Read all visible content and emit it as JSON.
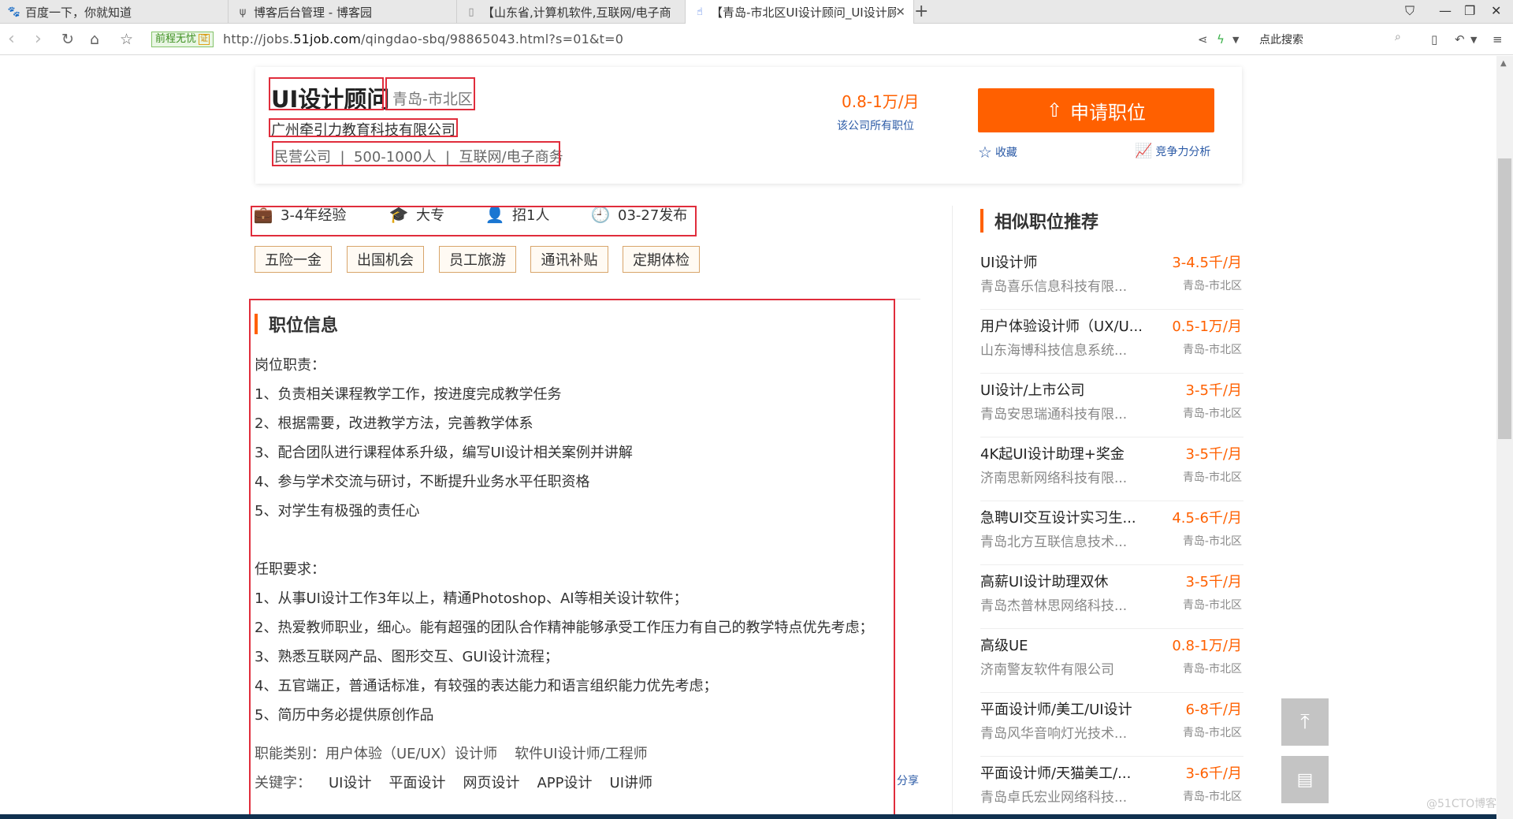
{
  "browser": {
    "tabs": [
      {
        "title": "百度一下，你就知道",
        "icon": "baidu-paw-icon",
        "active": false
      },
      {
        "title": "博客后台管理 - 博客园",
        "icon": "cnblogs-icon",
        "active": false
      },
      {
        "title": "【山东省,计算机软件,互联网/电子商",
        "icon": "page-icon",
        "active": false
      },
      {
        "title": "【青岛-市北区UI设计顾问_UI设计顾",
        "icon": "hand-icon",
        "active": true
      }
    ],
    "secure_label": "前程无忧",
    "secure_cert": "证",
    "url_prefix": "http://jobs.",
    "url_domain": "51job.com",
    "url_path": "/qingdao-sbq/98865043.html?s=01&t=0",
    "search_placeholder": "点此搜索"
  },
  "job": {
    "title": "UI设计顾问",
    "location": "青岛-市北区",
    "company": "广州牵引力教育科技有限公司",
    "company_meta": "民营公司  |  500-1000人  |  互联网/电子商务",
    "salary": "0.8-1万/月",
    "all_jobs_link": "该公司所有职位",
    "apply_label": "申请职位",
    "favorite_label": "收藏",
    "analysis_label": "竞争力分析"
  },
  "requirements": [
    {
      "icon": "briefcase-icon",
      "text": "3-4年经验"
    },
    {
      "icon": "graduation-cap-icon",
      "text": "大专"
    },
    {
      "icon": "person-icon",
      "text": "招1人"
    },
    {
      "icon": "clock-icon",
      "text": "03-27发布"
    }
  ],
  "welfare": [
    "五险一金",
    "出国机会",
    "员工旅游",
    "通讯补贴",
    "定期体检"
  ],
  "description": {
    "heading": "职位信息",
    "lines": [
      "岗位职责：",
      "1、负责相关课程教学工作，按进度完成教学任务",
      "2、根据需要，改进教学方法，完善教学体系",
      "3、配合团队进行课程体系升级，编写UI设计相关案例并讲解",
      "4、参与学术交流与研讨，不断提升业务水平任职资格",
      "5、对学生有极强的责任心",
      "",
      "任职要求：",
      "1、从事UI设计工作3年以上，精通Photoshop、AI等相关设计软件；",
      "2、热爱教师职业，细心。能有超强的团队合作精神能够承受工作压力有自己的教学特点优先考虑；",
      "3、熟悉互联网产品、图形交互、GUI设计流程；",
      "4、五官端正，普通话标准，有较强的表达能力和语言组织能力优先考虑；",
      "5、简历中务必提供原创作品"
    ],
    "category_label": "职能类别：",
    "categories": [
      "用户体验（UE/UX）设计师",
      "软件UI设计师/工程师"
    ],
    "keyword_label": "关键字：",
    "keywords": [
      "UI设计",
      "平面设计",
      "网页设计",
      "APP设计",
      "UI讲师"
    ],
    "share_label": "分享"
  },
  "recommend": {
    "heading": "相似职位推荐",
    "items": [
      {
        "title": "UI设计师",
        "salary": "3-4.5千/月",
        "company": "青岛喜乐信息科技有限...",
        "location": "青岛-市北区"
      },
      {
        "title": "用户体验设计师（UX/U...",
        "salary": "0.5-1万/月",
        "company": "山东海博科技信息系统...",
        "location": "青岛-市北区"
      },
      {
        "title": "UI设计/上市公司",
        "salary": "3-5千/月",
        "company": "青岛安思瑞通科技有限...",
        "location": "青岛-市北区"
      },
      {
        "title": "4K起UI设计助理+奖金",
        "salary": "3-5千/月",
        "company": "济南思新网络科技有限...",
        "location": "青岛-市北区"
      },
      {
        "title": "急聘UI交互设计实习生...",
        "salary": "4.5-6千/月",
        "company": "青岛北方互联信息技术...",
        "location": "青岛-市北区"
      },
      {
        "title": "高薪UI设计助理双休",
        "salary": "3-5千/月",
        "company": "青岛杰普林思网络科技...",
        "location": "青岛-市北区"
      },
      {
        "title": "高级UE",
        "salary": "0.8-1万/月",
        "company": "济南警友软件有限公司",
        "location": "青岛-市北区"
      },
      {
        "title": "平面设计师/美工/UI设计",
        "salary": "6-8千/月",
        "company": "青岛风华音响灯光技术...",
        "location": "青岛-市北区"
      },
      {
        "title": "平面设计师/天猫美工/...",
        "salary": "3-6千/月",
        "company": "青岛卓氏宏业网络科技...",
        "location": "青岛-市北区"
      }
    ]
  },
  "watermark": "@51CTO博客",
  "colors": {
    "accent": "#ff6000",
    "highlight_box": "#e02d3c",
    "link": "#2b5aa6"
  }
}
